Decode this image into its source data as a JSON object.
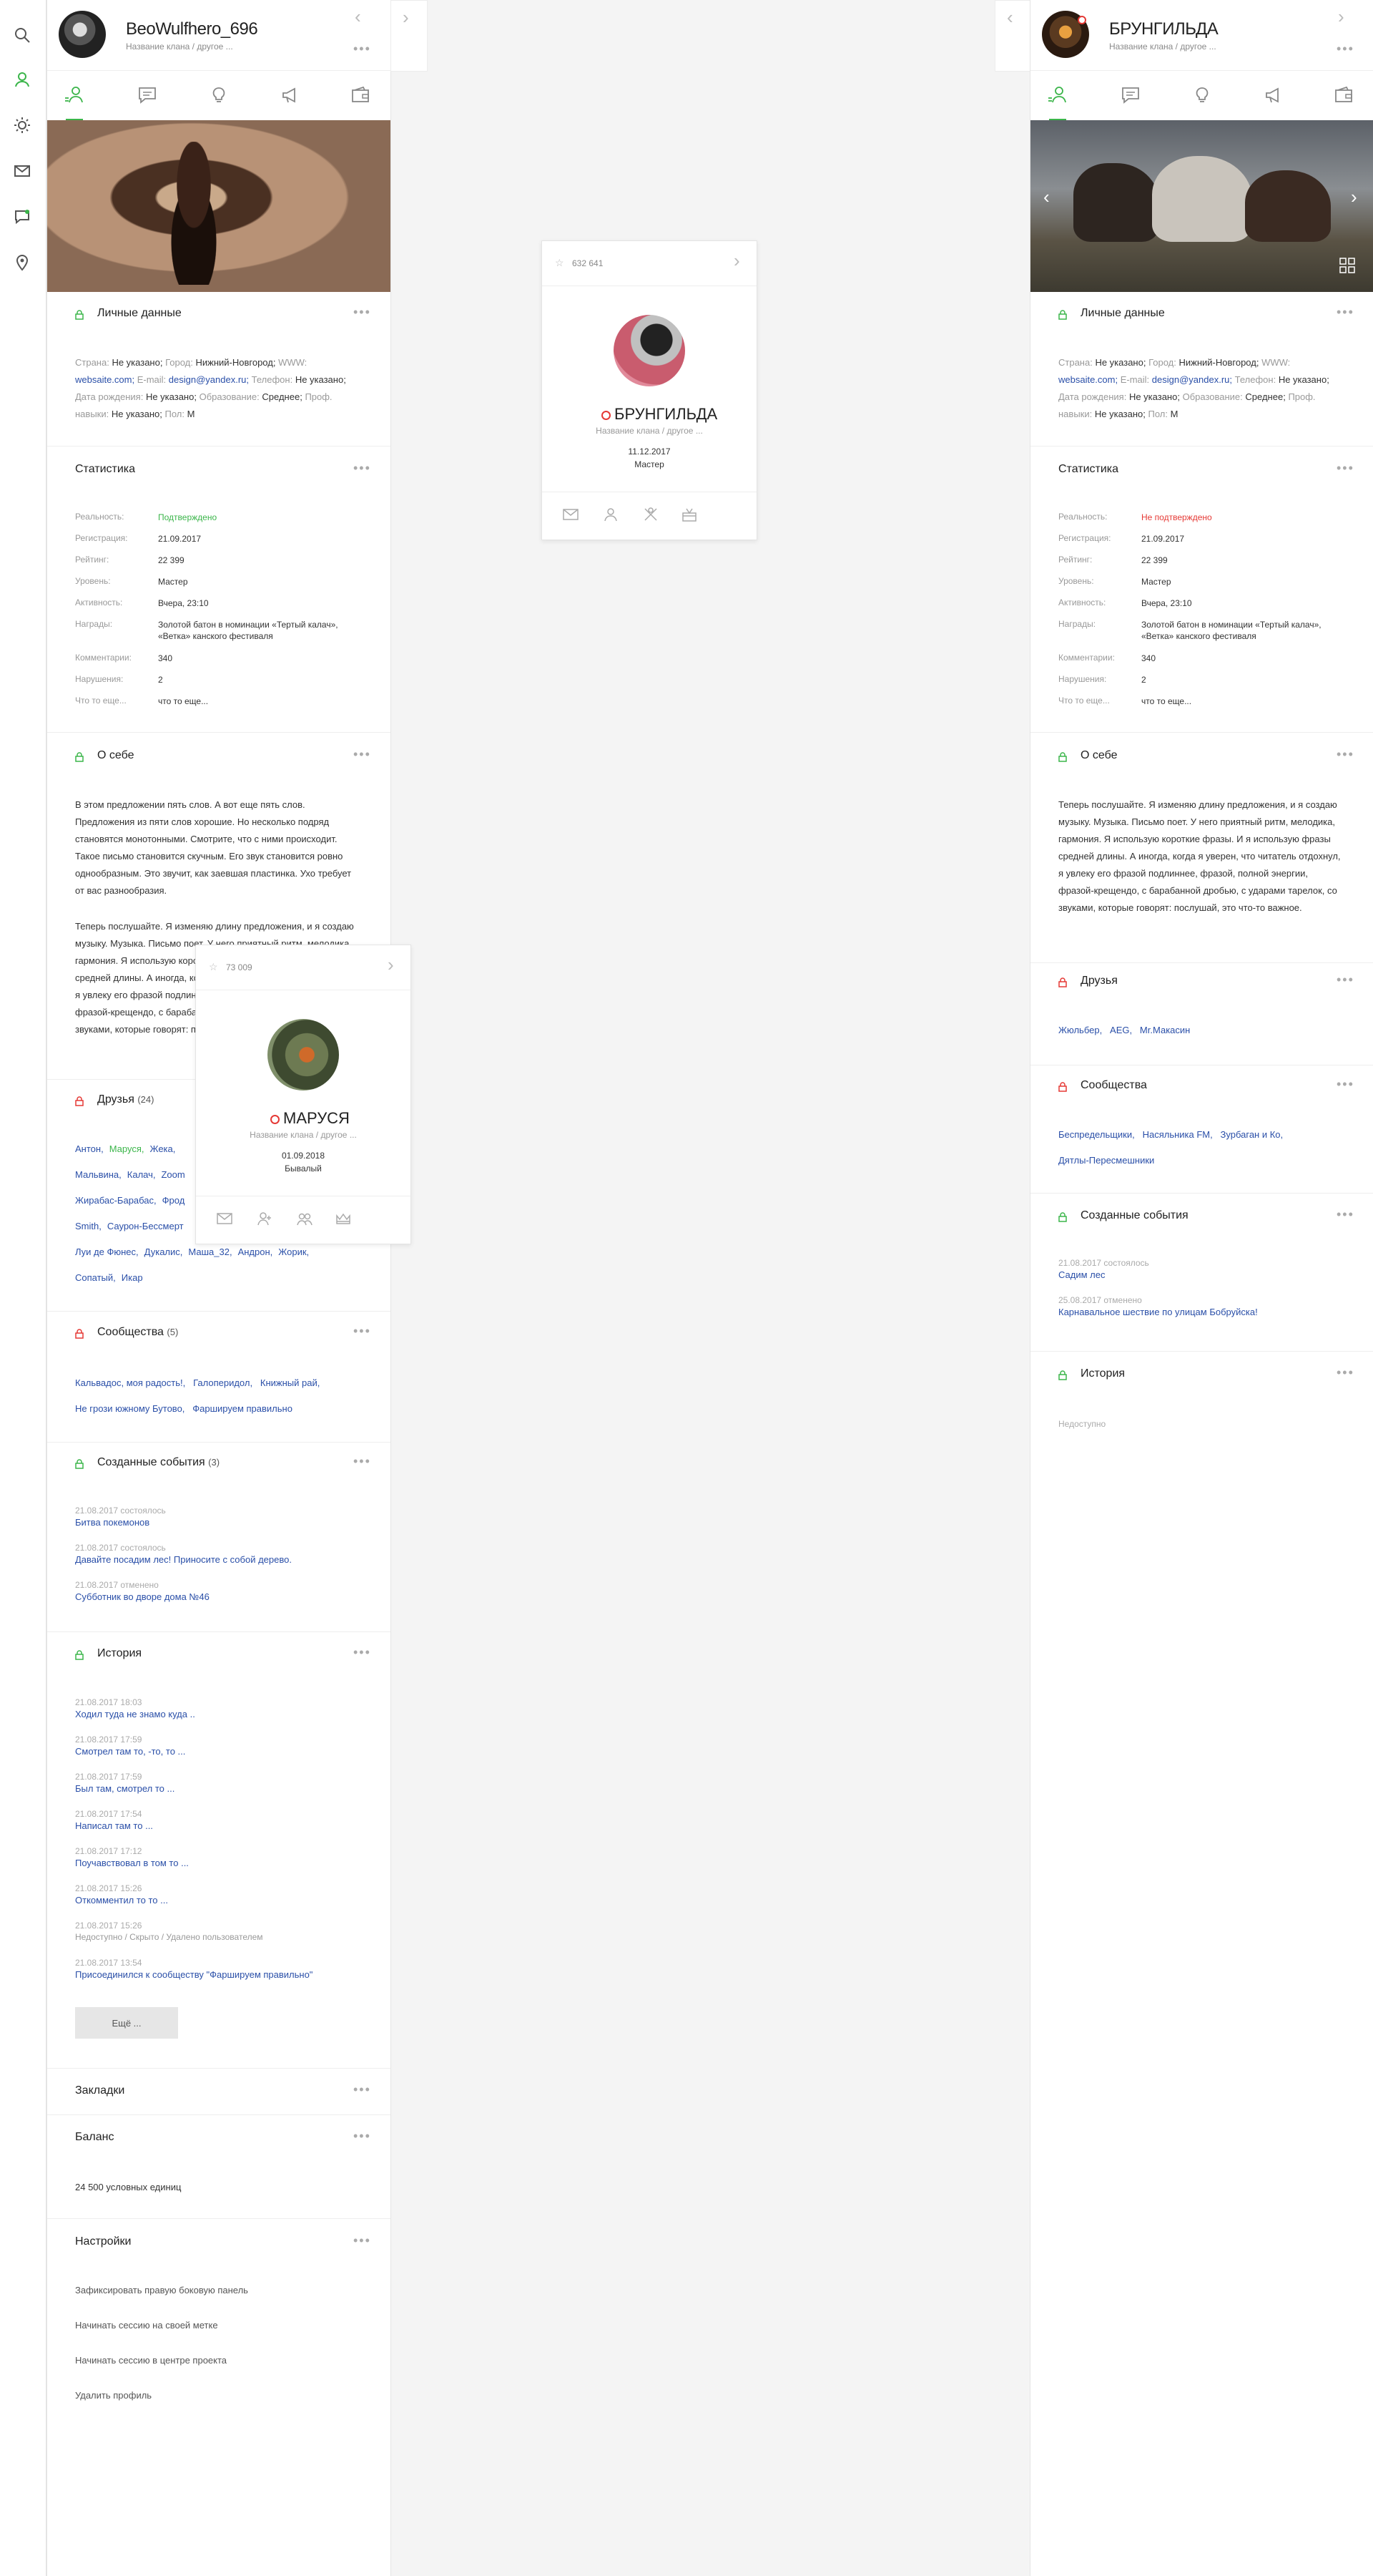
{
  "left_profile": {
    "username": "BeoWulfhero_696",
    "clan": "Название клана / другое ...",
    "personal": {
      "title": "Личные данные",
      "country_k": "Страна:",
      "country_v": "Не указано;",
      "city_k": "Город:",
      "city_v": "Нижний-Новгород;",
      "www_k": "WWW:",
      "www_v": "websaite.com;",
      "email_k": "E-mail:",
      "email_v": "design@yandex.ru;",
      "phone_k": "Телефон:",
      "phone_v": "Не указано;",
      "bday_k": "Дата рождения:",
      "bday_v": "Не указано;",
      "edu_k": "Образование:",
      "edu_v": "Среднее;",
      "prof_k": "Проф. навыки:",
      "prof_v": "Не указано;",
      "sex_k": "Пол:",
      "sex_v": "М"
    },
    "stats": {
      "title": "Статистика",
      "rows": [
        {
          "k": "Реальность:",
          "v": "Подтверждено"
        },
        {
          "k": "Регистрация:",
          "v": "21.09.2017"
        },
        {
          "k": "Рейтинг:",
          "v": "22 399"
        },
        {
          "k": "Уровень:",
          "v": "Мастер"
        },
        {
          "k": "Активность:",
          "v": "Вчера, 23:10"
        },
        {
          "k": "Награды:",
          "v": "Золотой батон в номинации «Тертый калач», «Ветка» канского фестиваля"
        },
        {
          "k": "Комментарии:",
          "v": "340"
        },
        {
          "k": "Нарушения:",
          "v": "2"
        },
        {
          "k": "Что то еще...",
          "v": "что то еще..."
        }
      ]
    },
    "about": {
      "title": "О себе",
      "p1": "В этом предложении пять слов. А вот еще пять слов. Предложения из пяти слов хорошие. Но несколько подряд становятся монотонными. Смотрите, что с ними происходит. Такое письмо становится скучным. Его звук становится ровно однообразным. Это звучит, как заевшая пластинка. Ухо требует от вас разнообразия.",
      "p2": "Теперь послушайте. Я изменяю длину предложения, и я создаю музыку. Музыка. Письмо поет. У него приятный ритм, мелодика, гармония. Я использую короткие фразы. И я использую фразы средней длины. А иногда, когда я уверен, что читатель отдохнул, я увлеку его фразой подлиннее, фразой, полной энергии, фразой-крещендо, с барабанной дробью, с ударами тарелок, со звуками, которые говорят: послушай, это что-то важное."
    },
    "friends": {
      "title": "Друзья",
      "count": "(24)",
      "lines": [
        [
          "Антон,",
          "Маруся,",
          "Жека,"
        ],
        [
          "Мальвина,",
          "Калач,",
          "Zoom"
        ],
        [
          "Жирабас-Барабас,",
          "Фрод"
        ],
        [
          "Smith,",
          "Саурон-Бессмерт"
        ],
        [
          "Луи де Фюнес,",
          "Дукалис,",
          "Маша_32,",
          "Андрон,",
          "Жорик,"
        ],
        [
          "Сопатый,",
          "Икар"
        ]
      ]
    },
    "communities": {
      "title": "Сообщества",
      "count": "(5)",
      "line1": "Кальвадос, моя радость!,   Галоперидол,   Книжный рай,",
      "line2": "Не грози южному Бутово,   Фаршируем правильно"
    },
    "events": {
      "title": "Созданные события",
      "count": "(3)",
      "items": [
        {
          "date": "21.08.2017",
          "status": "состоялось",
          "name": "Битва покемонов"
        },
        {
          "date": "21.08.2017",
          "status": "состоялось",
          "name": "Давайте посадим лес! Приносите с собой дерево."
        },
        {
          "date": "21.08.2017",
          "status": "отменено",
          "name": "Субботник во дворе дома №46"
        }
      ]
    },
    "history": {
      "title": "История",
      "items": [
        {
          "date": "21.08.2017 18:03",
          "name": "Ходил туда не знамо куда ..",
          "muted": false
        },
        {
          "date": "21.08.2017 17:59",
          "name": "Смотрел там то, -то, то ...",
          "muted": false
        },
        {
          "date": "21.08.2017 17:59",
          "name": "Был там, смотрел то ...",
          "muted": false
        },
        {
          "date": "21.08.2017 17:54",
          "name": "Написал там то ...",
          "muted": false
        },
        {
          "date": "21.08.2017 17:12",
          "name": "Поучавствовал в том то ...",
          "muted": false
        },
        {
          "date": "21.08.2017 15:26",
          "name": "Откомментил то то ...",
          "muted": false
        },
        {
          "date": "21.08.2017 15:26",
          "name": "Недоступно / Скрыто / Удалено пользователем",
          "muted": true
        },
        {
          "date": "21.08.2017 13:54",
          "name": "Присоединился к сообществу \"Фаршируем правильно\"",
          "muted": false
        }
      ],
      "more": "Ещё ..."
    },
    "bookmarks": {
      "title": "Закладки"
    },
    "balance": {
      "title": "Баланс",
      "value": "24 500 условных единиц"
    },
    "settings": {
      "title": "Настройки",
      "items": [
        "Зафиксировать правую боковую панель",
        "Начинать сессию на своей метке",
        "Начинать сессию в центре проекта",
        "Удалить профиль"
      ]
    }
  },
  "center_card": {
    "rating": "632 641",
    "name": "БРУНГИЛЬДА",
    "clan": "Название клана / другое ...",
    "date": "11.12.2017",
    "level": "Мастер"
  },
  "popup_card": {
    "rating": "73 009",
    "name": "МАРУСЯ",
    "clan": "Название клана / другое ...",
    "date": "01.09.2018",
    "level": "Бывалый"
  },
  "right_profile": {
    "username": "БРУНГИЛЬДА",
    "clan": "Название клана / другое ...",
    "personal": {
      "title": "Личные данные",
      "country_k": "Страна:",
      "country_v": "Не указано;",
      "city_k": "Город:",
      "city_v": "Нижний-Новгород;",
      "www_k": "WWW:",
      "www_v": "websaite.com;",
      "email_k": "E-mail:",
      "email_v": "design@yandex.ru;",
      "phone_k": "Телефон:",
      "phone_v": "Не указано;",
      "bday_k": "Дата рождения:",
      "bday_v": "Не указано;",
      "edu_k": "Образование:",
      "edu_v": "Среднее;",
      "prof_k": "Проф. навыки:",
      "prof_v": "Не указано;",
      "sex_k": "Пол:",
      "sex_v": "М"
    },
    "stats": {
      "title": "Статистика",
      "rows": [
        {
          "k": "Реальность:",
          "v": "Не подтверждено"
        },
        {
          "k": "Регистрация:",
          "v": "21.09.2017"
        },
        {
          "k": "Рейтинг:",
          "v": "22 399"
        },
        {
          "k": "Уровень:",
          "v": "Мастер"
        },
        {
          "k": "Активность:",
          "v": "Вчера, 23:10"
        },
        {
          "k": "Награды:",
          "v": "Золотой батон в номинации «Тертый калач», «Ветка» канского фестиваля"
        },
        {
          "k": "Комментарии:",
          "v": "340"
        },
        {
          "k": "Нарушения:",
          "v": "2"
        },
        {
          "k": "Что то еще...",
          "v": "что то еще..."
        }
      ]
    },
    "about": {
      "title": "О себе",
      "p1": "Теперь послушайте. Я изменяю длину предложения, и я создаю музыку. Музыка. Письмо поет. У него приятный ритм, мелодика, гармония. Я использую короткие фразы. И я использую фразы средней длины. А иногда, когда я уверен, что читатель отдохнул, я увлеку его фразой подлиннее, фразой, полной энергии, фразой-крещендо, с барабанной дробью, с ударами тарелок, со звуками, которые говорят: послушай, это что-то важное."
    },
    "friends": {
      "title": "Друзья",
      "line": "Жюльбер,   AEG,   Mr.Макасин"
    },
    "communities": {
      "title": "Сообщества",
      "line1": "Беспредельщики,   Насяльника FM,   Зурбаган и Ко,",
      "line2": "Дятлы-Пересмешники"
    },
    "events": {
      "title": "Созданные события",
      "items": [
        {
          "date": "21.08.2017",
          "status": "состоялось",
          "name": "Садим лес"
        },
        {
          "date": "25.08.2017",
          "status": "отменено",
          "name": "Карнавальное шествие по улицам Бобруйска!"
        }
      ]
    },
    "history": {
      "title": "История",
      "value": "Недоступно"
    }
  },
  "colors": {
    "accent": "#3bb54a",
    "link": "#2a4fa8",
    "danger": "#e53935"
  }
}
